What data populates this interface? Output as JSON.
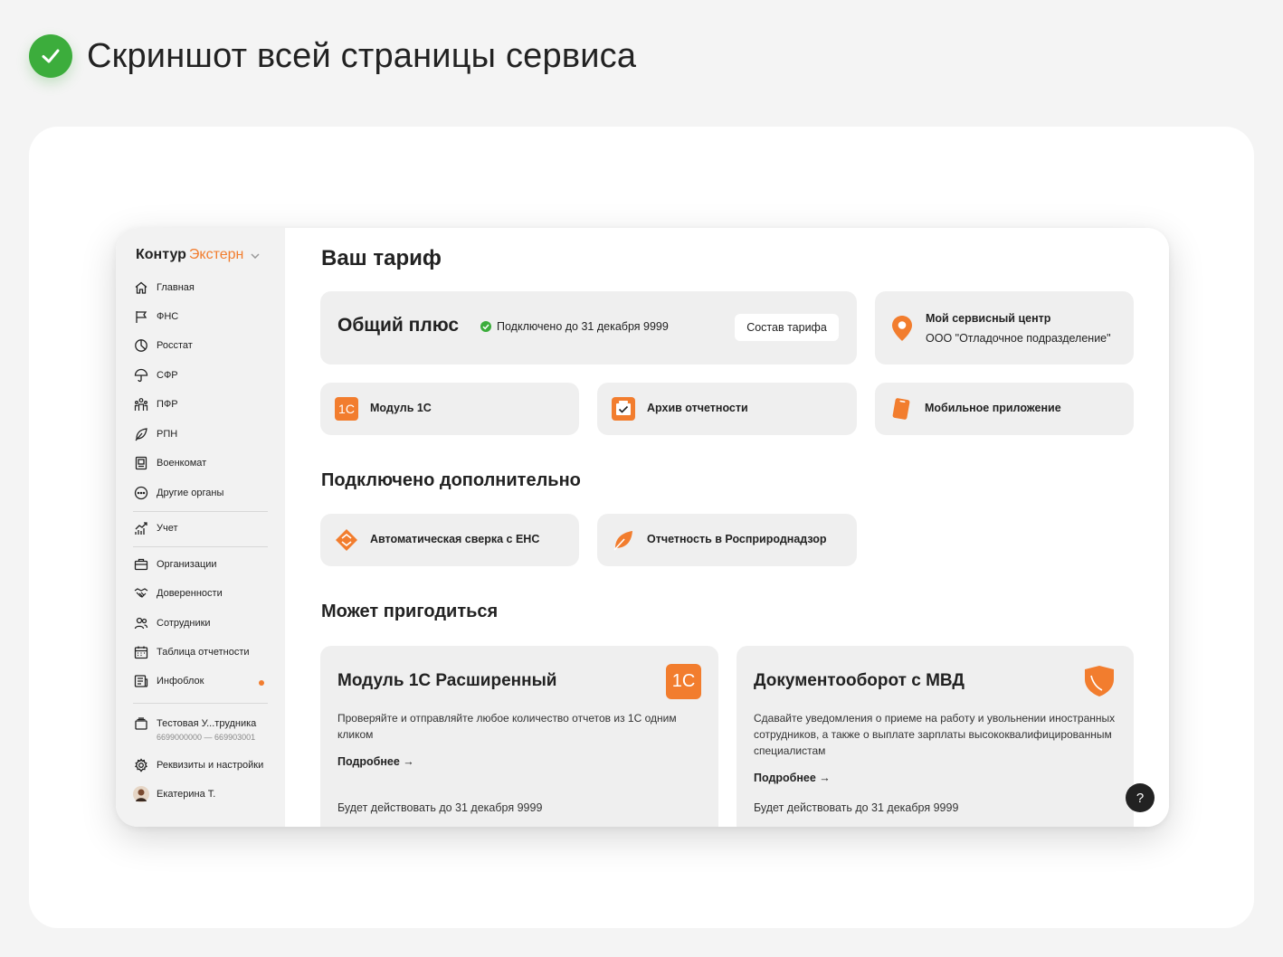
{
  "page_header": {
    "title": "Скриншот всей страницы сервиса"
  },
  "colors": {
    "accent": "#f27d2e",
    "success": "#3cad3c"
  },
  "sidebar": {
    "logo": {
      "brand": "Контур",
      "product": "Экстерн"
    },
    "items": [
      {
        "label": "Главная",
        "icon": "home-icon"
      },
      {
        "label": "ФНС",
        "icon": "flag-icon"
      },
      {
        "label": "Росстат",
        "icon": "pie-chart-icon"
      },
      {
        "label": "СФР",
        "icon": "umbrella-icon"
      },
      {
        "label": "ПФР",
        "icon": "people-group-icon"
      },
      {
        "label": "РПН",
        "icon": "leaf-icon"
      },
      {
        "label": "Военкомат",
        "icon": "id-card-icon"
      },
      {
        "label": "Другие органы",
        "icon": "more-icon"
      },
      {
        "label": "Учет",
        "icon": "growth-chart-icon"
      },
      {
        "label": "Организации",
        "icon": "briefcase-icon"
      },
      {
        "label": "Доверенности",
        "icon": "handshake-icon"
      },
      {
        "label": "Сотрудники",
        "icon": "users-icon"
      },
      {
        "label": "Таблица отчетности",
        "icon": "calendar-icon"
      },
      {
        "label": "Инфоблок",
        "icon": "news-icon"
      }
    ],
    "org": {
      "name": "Тестовая У...трудника",
      "ids": "6699000000 — 669903001"
    },
    "settings_label": "Реквизиты и настройки",
    "user_name": "Екатерина Т."
  },
  "main": {
    "title": "Ваш тариф",
    "tariff": {
      "name": "Общий плюс",
      "status": "Подключено до 31 декабря 9999",
      "button": "Состав тарифа"
    },
    "service_center": {
      "title": "Мой сервисный центр",
      "name": "ООО \"Отладочное подразделение\""
    },
    "features": [
      {
        "label": "Модуль 1С",
        "icon": "1c-icon"
      },
      {
        "label": "Архив отчетности",
        "icon": "archive-icon"
      },
      {
        "label": "Мобильное приложение",
        "icon": "phone-icon"
      }
    ],
    "extra_title": "Подключено дополнительно",
    "extras": [
      {
        "label": "Автоматическая сверка с ЕНС",
        "icon": "ens-icon"
      },
      {
        "label": "Отчетность в Росприроднадзор",
        "icon": "leaf-icon"
      }
    ],
    "suggest_title": "Может пригодиться",
    "suggestions": [
      {
        "title": "Модуль 1С Расширенный",
        "desc": "Проверяйте и отправляйте любое количество отчетов из 1С одним кликом",
        "more": "Подробнее →",
        "until": "Будет действовать до 31 декабря 9999",
        "icon": "1c-icon",
        "icon_text": "1С"
      },
      {
        "title": "Документооборот с МВД",
        "desc": "Сдавайте уведомления о приеме на работу и увольнении иностранных сотрудников, а также о выплате зарплаты высококвалифицированным специалистам",
        "more": "Подробнее →",
        "until": "Будет действовать до 31 декабря 9999",
        "icon": "shield-icon"
      }
    ],
    "help_label": "?"
  }
}
